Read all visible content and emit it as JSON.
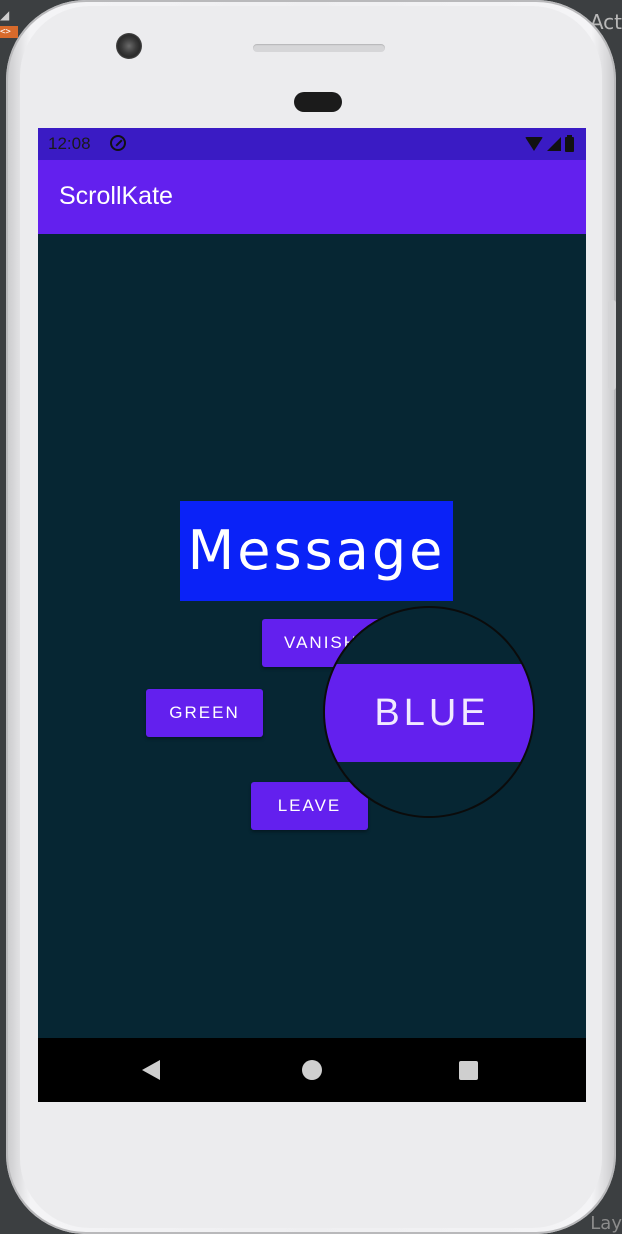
{
  "ide": {
    "right_top_text": "Act",
    "right_bottom_text": "Lay",
    "tag_text": "<>"
  },
  "status_bar": {
    "time": "12:08"
  },
  "app_bar": {
    "title": "ScrollKate"
  },
  "content": {
    "message_text": "Message",
    "buttons": {
      "vanish": "VANISH",
      "green": "GREEN",
      "leave": "LEAVE",
      "blue": "BLUE"
    }
  },
  "colors": {
    "primary": "#6320ee",
    "primary_dark": "#3a1bc4",
    "background": "#062633",
    "message_bg": "#0a22f7"
  },
  "icons": {
    "status": [
      "sync-icon",
      "wifi-icon",
      "signal-icon",
      "battery-icon"
    ],
    "nav": [
      "back-icon",
      "home-icon",
      "recents-icon"
    ]
  }
}
